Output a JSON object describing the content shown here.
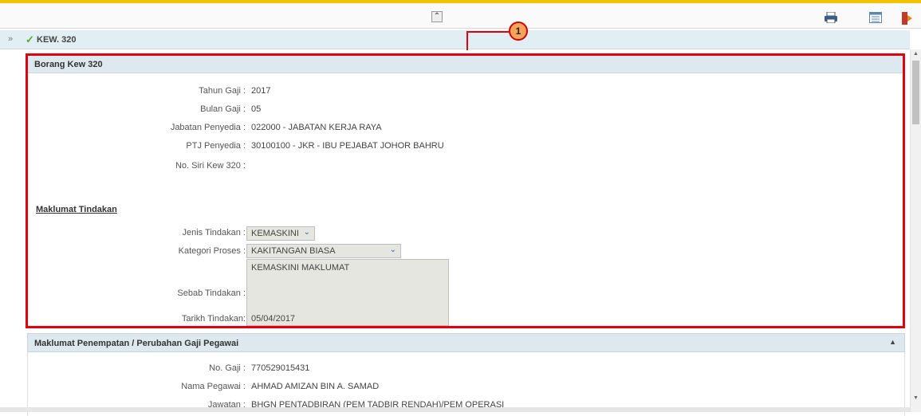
{
  "breadcrumb": {
    "title": "KEW. 320"
  },
  "toolbar": {
    "collapse_glyph": "«"
  },
  "callout": {
    "number": "1"
  },
  "form": {
    "section_title": "Borang Kew 320",
    "fields": [
      {
        "label": "Tahun Gaji :",
        "value": "2017"
      },
      {
        "label": "Bulan Gaji :",
        "value": "05"
      },
      {
        "label": "Jabatan Penyedia :",
        "value": "022000 - JABATAN KERJA RAYA"
      },
      {
        "label": "PTJ Penyedia :",
        "value": "30100100 - JKR - IBU PEJABAT JOHOR BAHRU"
      },
      {
        "label": "No. Siri Kew 320 :",
        "value": ""
      }
    ],
    "subheading": "Maklumat Tindakan",
    "jenis_label": "Jenis Tindakan :",
    "jenis_value": "KEMASKINI",
    "kategori_label": "Kategori Proses :",
    "kategori_value": "KAKITANGAN BIASA",
    "sebab_label": "Sebab Tindakan :",
    "sebab_value": "KEMASKINI MAKLUMAT",
    "tarikh_label": "Tarikh Tindakan:",
    "tarikh_value": "05/04/2017"
  },
  "placement": {
    "section_title": "Maklumat Penempatan / Perubahan Gaji Pegawai",
    "fields": [
      {
        "label": "No. Gaji :",
        "value": "770529015431"
      },
      {
        "label": "Nama Pegawai :",
        "value": "AHMAD AMIZAN BIN A. SAMAD"
      },
      {
        "label": "Jawatan :",
        "value": "BHGN PENTADBIRAN (PEM TADBIR RENDAH)/PEM OPERASI"
      }
    ]
  },
  "colors": {
    "highlight": "#e0000f",
    "header_bg": "#dde9ef",
    "accent": "#f2c400"
  }
}
